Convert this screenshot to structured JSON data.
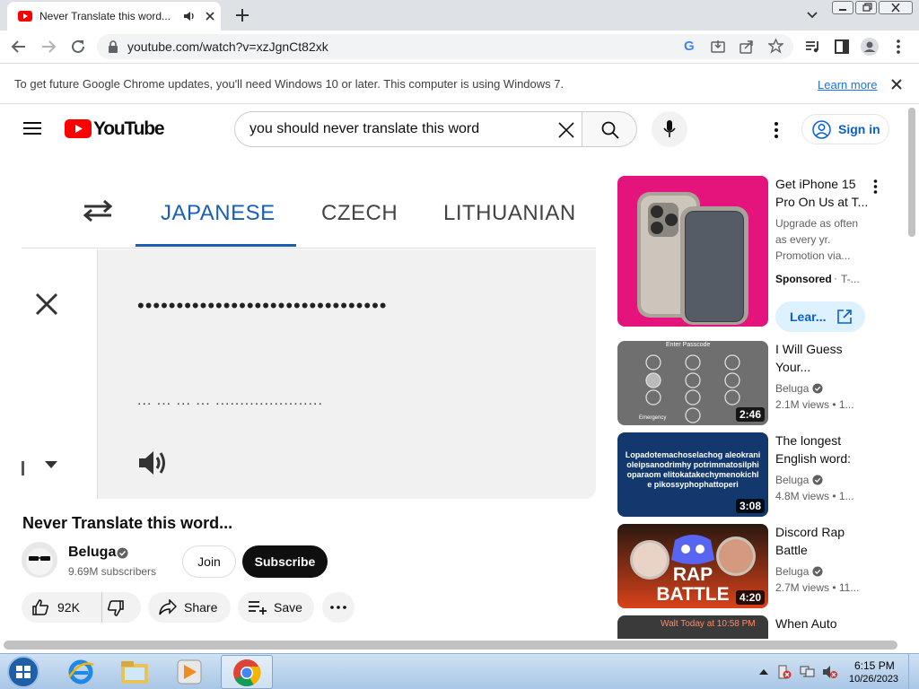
{
  "browser": {
    "tab_title": "Never Translate this word... -",
    "url": "youtube.com/watch?v=xzJgnCt82xk",
    "infobar_text": "To get future Google Chrome updates, you'll need Windows 10 or later. This computer is using Windows 7.",
    "infobar_link": "Learn more"
  },
  "header": {
    "logo_text": "YouTube",
    "search_value": "you should never translate this word",
    "signin_label": "Sign in"
  },
  "video": {
    "languages": [
      "JAPANESE",
      "CZECH",
      "LITHUANIAN"
    ],
    "selected_language": "JAPANESE",
    "translation_text": "••••••••••••••••••••••••••••••••",
    "transliteration_text": "... ... ... ... ......................",
    "title": "Never Translate this word...",
    "channel": "Beluga",
    "subscribers": "9.69M subscribers",
    "join_label": "Join",
    "subscribe_label": "Subscribe",
    "likes": "92K",
    "share_label": "Share",
    "save_label": "Save"
  },
  "sidebar": {
    "ad": {
      "title": "Get iPhone 15 Pro On Us at T...",
      "description": "Upgrade as often as every yr. Promotion via...",
      "sponsored": "Sponsored",
      "advertiser": "T-...",
      "cta": "Lear..."
    },
    "videos": [
      {
        "title": "I Will Guess Your...",
        "channel": "Beluga",
        "meta": "2.1M views • 1...",
        "duration": "2:46"
      },
      {
        "title": "The longest English word:",
        "channel": "Beluga",
        "meta": "4.8M views • 1...",
        "duration": "3:08",
        "thumb_text": "Lopadotemachoselachog aleokranioleipsanodrimhy potrimmatosilphioparaom elitokatakechymenokichle pikossyphophattoperi"
      },
      {
        "title": "Discord Rap Battle",
        "channel": "Beluga",
        "meta": "2.7M views • 11...",
        "duration": "4:20",
        "thumb_text": "RAP BATTLE"
      },
      {
        "title": "When Auto",
        "thumb_text": "Walt Today at 10:58 PM"
      }
    ],
    "thumb1_header": "Enter Passcode",
    "thumb1_footer": "Emergency"
  },
  "taskbar": {
    "time": "6:15 PM",
    "date": "10/26/2023"
  },
  "colors": {
    "youtube_red": "#ff0000",
    "link_blue": "#065fd4",
    "tab_blue": "#1a5fb4",
    "ad_pink": "#e5147c"
  }
}
